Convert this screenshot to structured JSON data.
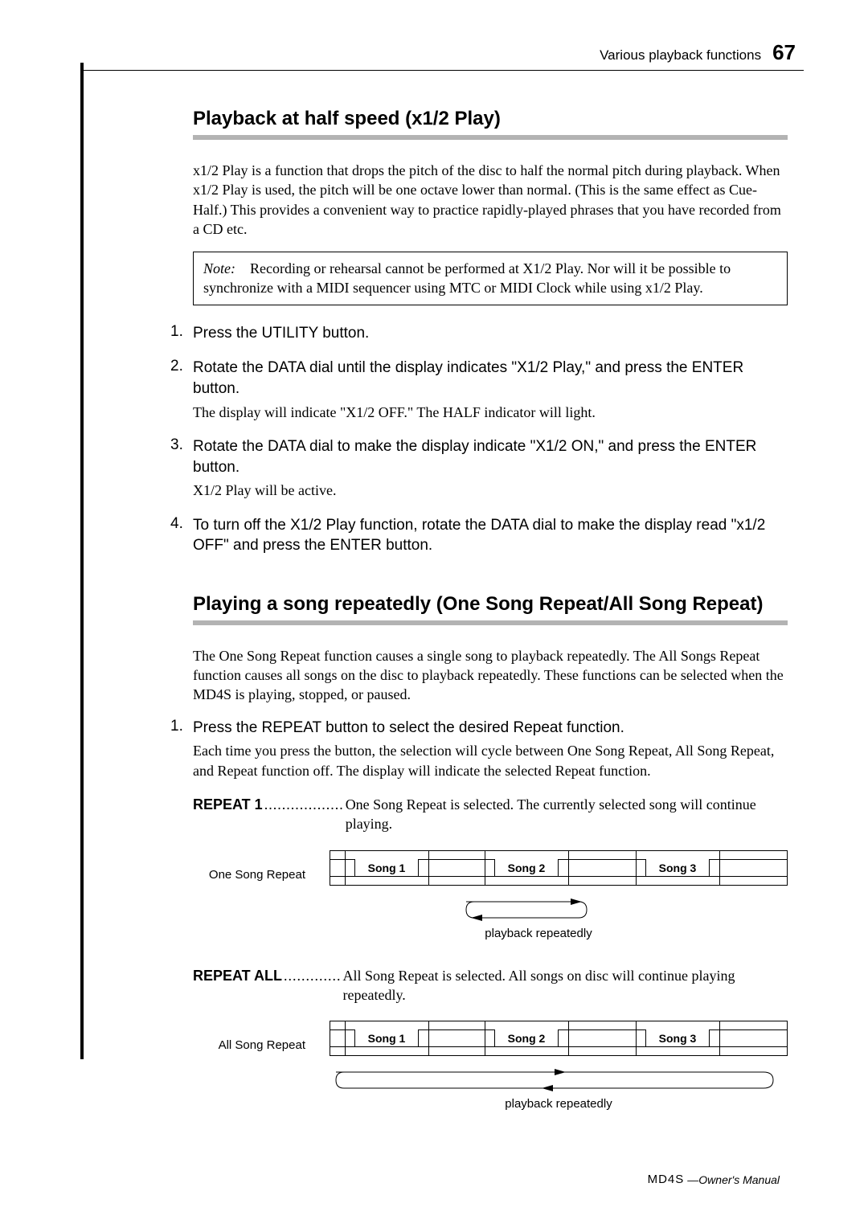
{
  "header": {
    "running_head": "Various playback functions",
    "page_number": "67"
  },
  "section1": {
    "title": "Playback at half speed (x1/2 Play)",
    "intro": "x1/2 Play is a function that drops the pitch of the disc to half the normal pitch during playback. When x1/2 Play is used, the pitch will be one octave lower than normal. (This is the same effect as Cue-Half.) This provides a convenient way to practice rapidly-played phrases that you have recorded from a CD etc.",
    "note_label": "Note:",
    "note_body": "Recording or rehearsal cannot be performed at X1/2 Play. Nor will it be possible to synchronize with a MIDI sequencer using MTC or MIDI Clock while using x1/2 Play.",
    "steps": [
      {
        "head": "Press the UTILITY button."
      },
      {
        "head": "Rotate the DATA dial until the display indicates \"X1/2 Play,\" and press the ENTER button.",
        "sub": "The display will indicate \"X1/2 OFF.\" The HALF indicator will light."
      },
      {
        "head": "Rotate the DATA dial to make the display indicate \"X1/2 ON,\" and press the ENTER button.",
        "sub": "X1/2 Play will be active."
      },
      {
        "head": "To turn off the X1/2 Play function, rotate the DATA dial to make the display read \"x1/2 OFF\" and press the ENTER button."
      }
    ]
  },
  "section2": {
    "title": "Playing a song repeatedly (One Song Repeat/All Song Repeat)",
    "intro": "The One Song Repeat function causes a single song to playback repeatedly. The All Songs Repeat function causes all songs on the disc to playback repeatedly. These functions can be selected when the MD4S is playing, stopped, or paused.",
    "steps": [
      {
        "head": "Press the REPEAT button to select the desired Repeat function.",
        "sub": "Each time you press the button, the selection will cycle between One Song Repeat, All Song Repeat, and Repeat function off. The display will indicate the selected Repeat function."
      }
    ],
    "defs": [
      {
        "label": "REPEAT 1",
        "dots": "..................",
        "desc": "One Song Repeat is selected. The currently selected song will continue playing."
      },
      {
        "label": "REPEAT ALL",
        "dots": ".............",
        "desc": "All Song Repeat is selected. All songs on disc will continue playing repeatedly."
      }
    ],
    "diagrams": {
      "one": {
        "side_label": "One Song Repeat",
        "songs": [
          "Song 1",
          "Song 2",
          "Song 3"
        ],
        "loop_caption": "playback repeatedly"
      },
      "all": {
        "side_label": "All Song Repeat",
        "songs": [
          "Song 1",
          "Song 2",
          "Song 3"
        ],
        "loop_caption": "playback repeatedly"
      }
    }
  },
  "footer": {
    "logo_text": "MD4S",
    "manual": "—Owner's Manual"
  }
}
